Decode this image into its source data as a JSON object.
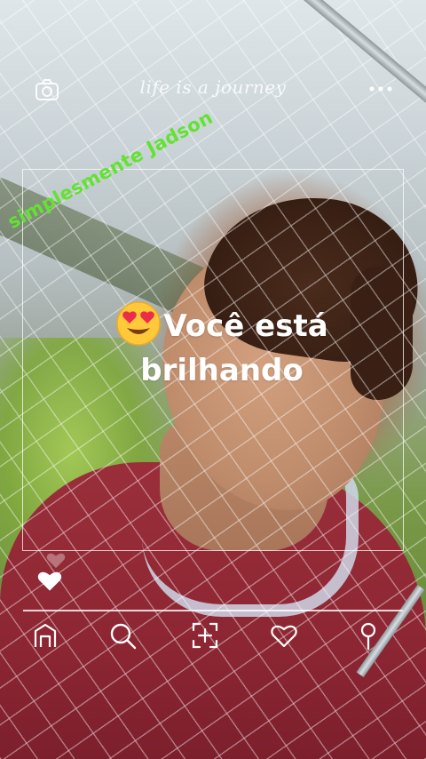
{
  "header": {
    "brand_text": "life is a journey",
    "camera_icon": "camera-icon",
    "more_icon": "more-icon"
  },
  "sticker": {
    "username": "simplesmente Jadson",
    "username_color": "#63e232"
  },
  "caption": {
    "emoji": "heart-eyes-emoji",
    "line1": "Você está",
    "line2": "brilhando"
  },
  "like_icon": "heart-icon",
  "bottom_nav": {
    "items": [
      "home-icon",
      "search-icon",
      "add-icon",
      "heart-outline-icon",
      "profile-icon"
    ]
  }
}
